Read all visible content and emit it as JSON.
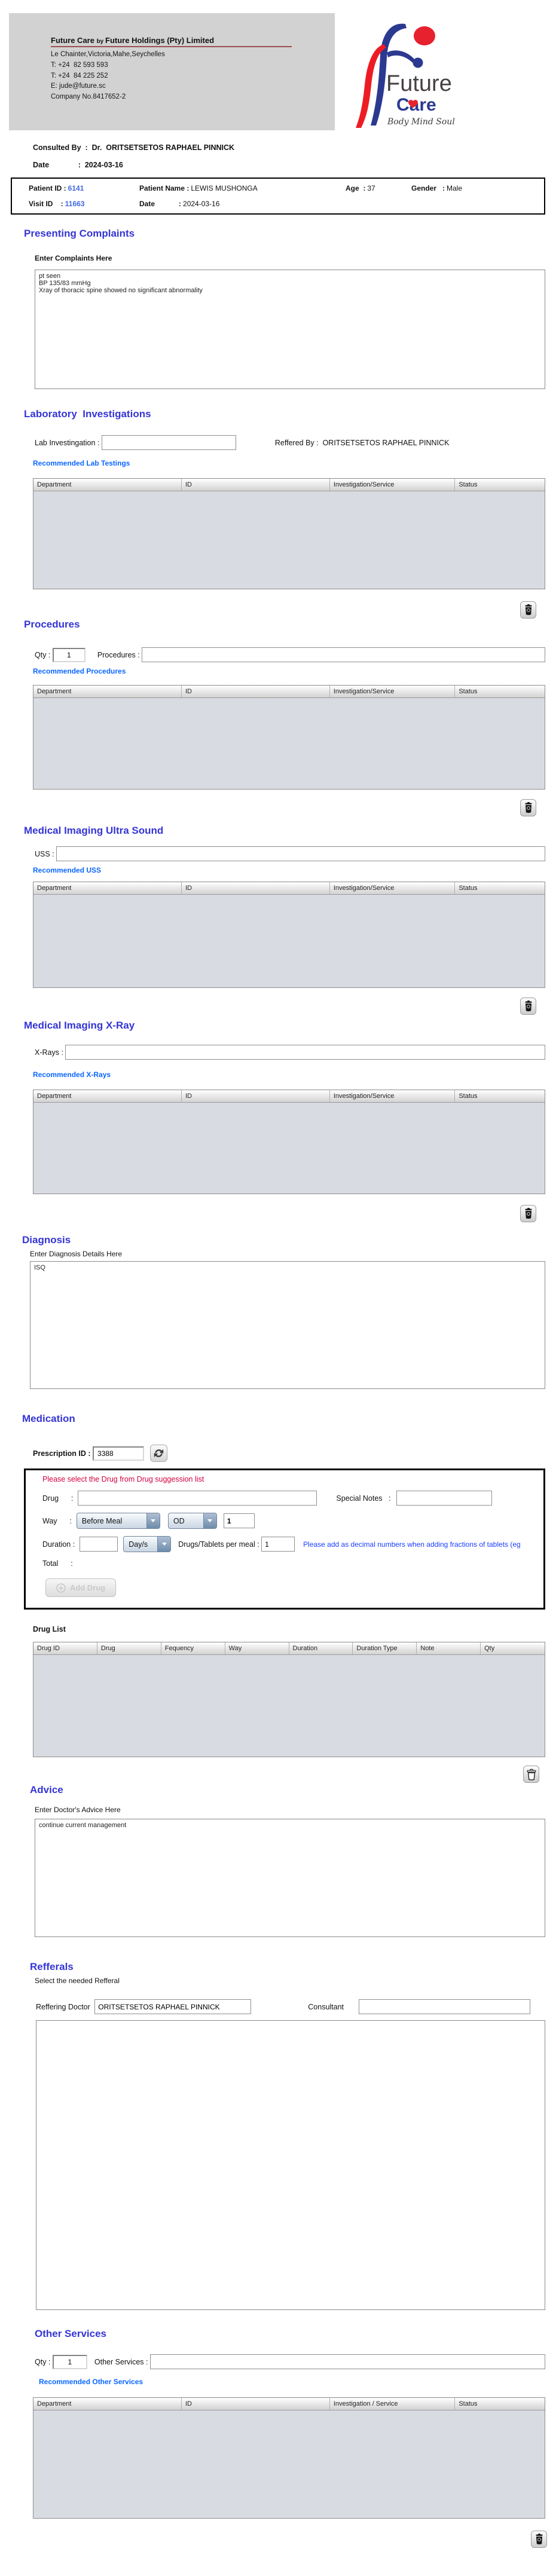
{
  "colors": {
    "section_heading": "#3434d6",
    "link_blue": "#0a66ff",
    "hint_red": "#d40040",
    "note_blue": "#1a3cff",
    "id_blue": "#4169e1",
    "logo_blue": "#2b3990",
    "logo_red": "#e8212e",
    "table_body_gray": "#d8dbe1",
    "header_band_gray": "#d2d2d2"
  },
  "header": {
    "company_title_main": "Future Care ",
    "company_title_by": "by ",
    "company_title_rest": "Future Holdings (Pty) Limited",
    "address": "Le Chainter,Victoria,Mahe,Seychelles",
    "phone1": "T: +24  82 593 593",
    "phone2": "T: +24  84 225 252",
    "email": "E: jude@future.sc",
    "company_no": "Company No.8417652-2",
    "logo": {
      "line1": "Future",
      "line2": "Care",
      "tagline": "Body Mind Soul"
    }
  },
  "consult": {
    "row1_label": "Consulted By  :  ",
    "row1_value": "Dr.  ORITSETSETOS RAPHAEL PINNICK",
    "row2_label": "Date              :  ",
    "row2_value": "2024-03-16"
  },
  "patient": {
    "patient_id_label": "Patient ID :",
    "patient_id": "6141",
    "patient_name_label": "Patient Name :",
    "patient_name": "LEWIS MUSHONGA",
    "age_label": "Age  :",
    "age": "37",
    "gender_label": "Gender   :",
    "gender": "Male",
    "visit_id_label": "Visit ID    :",
    "visit_id": "11663",
    "visit_date_label": "Date            :",
    "visit_date": "2024-03-16"
  },
  "presenting_complaints": {
    "title": "Presenting Complaints",
    "label": "Enter Complaints Here",
    "value": "pt seen\nBP 135/83 mmHg\nXray of thoracic spine showed no significant abnormality"
  },
  "laboratory": {
    "title": "Laboratory  Investigations",
    "lab_label": "Lab Investingation : ",
    "lab_value": "",
    "referred_by_label": "Reffered By :  ",
    "referred_by_value": "ORITSETSETOS RAPHAEL PINNICK",
    "recommended_link": "Recommended Lab Testings",
    "table_headers": [
      "Department",
      "ID",
      "Investigation/Service",
      "Status"
    ]
  },
  "procedures": {
    "title": "Procedures",
    "qty_label": "Qty : ",
    "qty_value": "1",
    "procedures_label": "Procedures : ",
    "procedures_value": "",
    "recommended_link": "Recommended Procedures",
    "table_headers": [
      "Department",
      "ID",
      "Investigation/Service",
      "Status"
    ]
  },
  "ultrasound": {
    "title": "Medical Imaging Ultra Sound",
    "uss_label": "USS : ",
    "uss_value": "",
    "recommended_link": "Recommended USS",
    "table_headers": [
      "Department",
      "ID",
      "Investigation/Service",
      "Status"
    ]
  },
  "xray": {
    "title": "Medical Imaging X-Ray",
    "xray_label": "X-Rays : ",
    "xray_value": "",
    "recommended_link": "Recommended X-Rays",
    "table_headers": [
      "Department",
      "ID",
      "Investigation/Service",
      "Status"
    ]
  },
  "diagnosis": {
    "title": "Diagnosis",
    "label": "Enter Diagnosis Details Here",
    "value": "ISQ"
  },
  "medication": {
    "title": "Medication",
    "prescription_id_label": "Prescription ID : ",
    "prescription_id": "3388",
    "hint": "Please select the Drug from Drug suggession list",
    "drug_label": "Drug      :",
    "drug_value": "",
    "special_notes_label": "Special Notes   :",
    "special_notes_value": "",
    "way_label": "Way      :",
    "way_value": "Before Meal",
    "frequency_value": "OD",
    "times_value": "1",
    "duration_label": "Duration :",
    "duration_value": "",
    "duration_type_value": "Day/s",
    "per_meal_label": "Drugs/Tablets per meal : ",
    "per_meal_value": "1",
    "fraction_note": "Please add as decimal numbers when adding fractions of tablets (eg",
    "total_label": "Total      :",
    "add_drug_label": "Add Drug",
    "drug_list_label": "Drug List",
    "drug_table_headers": [
      "Drug ID",
      "Drug",
      "Fequency",
      "Way",
      "Duration",
      "Duration Type",
      "Note",
      "Qty"
    ]
  },
  "advice": {
    "title": "Advice",
    "label": "Enter Doctor's Advice Here",
    "value": "continue current management"
  },
  "referrals": {
    "title": "Refferals",
    "subtitle": "Select the needed Refferal",
    "referring_doctor_label": "Reffering Doctor ",
    "referring_doctor_value": "ORITSETSETOS RAPHAEL PINNICK",
    "consultant_label": "Consultant",
    "consultant_value": ""
  },
  "other_services": {
    "title": "Other Services",
    "qty_label": "Qty : ",
    "qty_value": "1",
    "services_label": "Other Services : ",
    "services_value": "",
    "recommended_link": "Recommended Other Services",
    "table_headers": [
      "Department",
      "ID",
      "Investigation / Service",
      "Status"
    ]
  }
}
